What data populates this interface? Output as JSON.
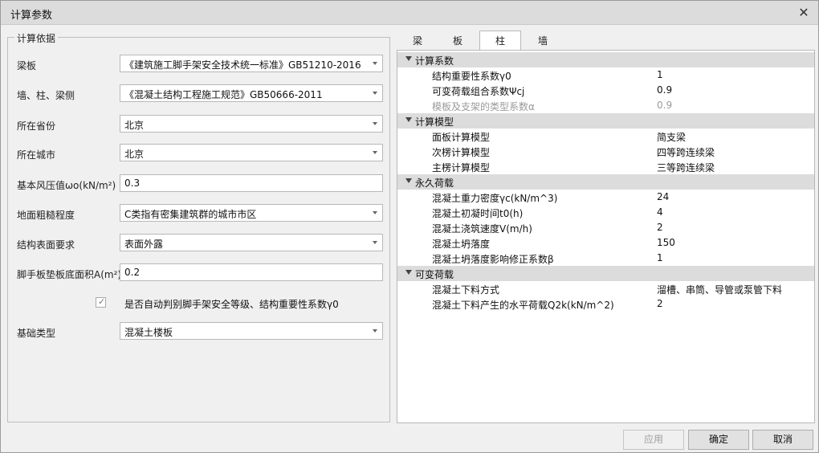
{
  "window": {
    "title": "计算参数"
  },
  "basis": {
    "legend": "计算依据",
    "rows": [
      {
        "label": "梁板",
        "value": "《建筑施工脚手架安全技术统一标准》GB51210-2016",
        "kind": "select"
      },
      {
        "label": "墙、柱、梁侧",
        "value": "《混凝土结构工程施工规范》GB50666-2011",
        "kind": "select"
      },
      {
        "label": "所在省份",
        "value": "北京",
        "kind": "select"
      },
      {
        "label": "所在城市",
        "value": "北京",
        "kind": "select"
      },
      {
        "label": "基本风压值ωo(kN/m²)",
        "value": "0.3",
        "kind": "input"
      },
      {
        "label": "地面粗糙程度",
        "value": "C类指有密集建筑群的城市市区",
        "kind": "select"
      },
      {
        "label": "结构表面要求",
        "value": "表面外露",
        "kind": "select"
      },
      {
        "label": "脚手板垫板底面积A(m²)",
        "value": "0.2",
        "kind": "input"
      }
    ],
    "auto_check": {
      "label": "是否自动判别脚手架安全等级、结构重要性系数γ0",
      "checked": true
    },
    "foundation": {
      "label": "基础类型",
      "value": "混凝土楼板"
    }
  },
  "tabs": [
    {
      "label": "梁",
      "active": false
    },
    {
      "label": "板",
      "active": false
    },
    {
      "label": "柱",
      "active": true
    },
    {
      "label": "墙",
      "active": false
    }
  ],
  "grid": {
    "sections": [
      {
        "title": "计算系数",
        "rows": [
          {
            "name": "结构重要性系数γ0",
            "value": "1",
            "disabled": false
          },
          {
            "name": "可变荷载组合系数Ψcj",
            "value": "0.9",
            "disabled": false
          },
          {
            "name": "模板及支架的类型系数α",
            "value": "0.9",
            "disabled": true
          }
        ]
      },
      {
        "title": "计算模型",
        "rows": [
          {
            "name": "面板计算模型",
            "value": "简支梁",
            "disabled": false
          },
          {
            "name": "次楞计算模型",
            "value": "四等跨连续梁",
            "disabled": false
          },
          {
            "name": "主楞计算模型",
            "value": "三等跨连续梁",
            "disabled": false
          }
        ]
      },
      {
        "title": "永久荷载",
        "rows": [
          {
            "name": "混凝土重力密度γc(kN/m^3)",
            "value": "24",
            "disabled": false
          },
          {
            "name": "混凝土初凝时间t0(h)",
            "value": "4",
            "disabled": false
          },
          {
            "name": "混凝土浇筑速度V(m/h)",
            "value": "2",
            "disabled": false
          },
          {
            "name": "混凝土坍落度",
            "value": "150",
            "disabled": false
          },
          {
            "name": "混凝土坍落度影响修正系数β",
            "value": "1",
            "disabled": false
          }
        ]
      },
      {
        "title": "可变荷载",
        "rows": [
          {
            "name": "混凝土下料方式",
            "value": "溜槽、串筒、导管或泵管下料",
            "disabled": false
          },
          {
            "name": "混凝土下料产生的水平荷载Q2k(kN/m^2)",
            "value": "2",
            "disabled": false
          }
        ]
      }
    ]
  },
  "buttons": {
    "apply": "应用",
    "ok": "确定",
    "cancel": "取消"
  }
}
